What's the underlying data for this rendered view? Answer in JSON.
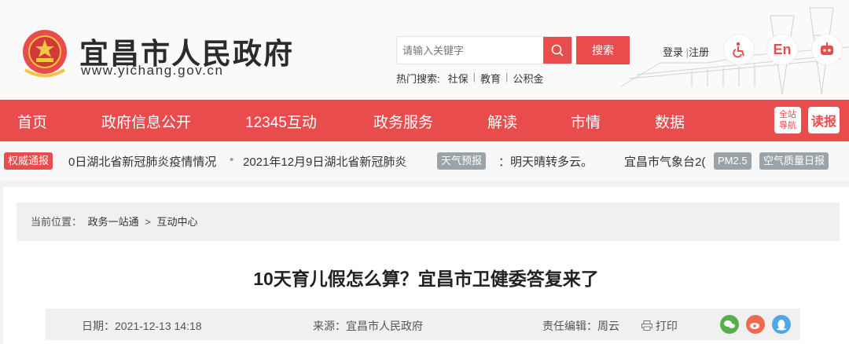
{
  "header": {
    "title": "宜昌市人民政府",
    "url": "www.yichang.gov.cn",
    "search": {
      "placeholder": "请输入关键字",
      "button": "搜索"
    },
    "hot": {
      "label": "热门搜索:",
      "items": [
        "社保",
        "教育",
        "公积金"
      ]
    },
    "login": "登录",
    "register": "注册",
    "en_label": "En",
    "colors": {
      "brand": "#e94c4c"
    }
  },
  "nav": {
    "items": [
      "首页",
      "政府信息公开",
      "12345互动",
      "政务服务",
      "解读",
      "市情",
      "数据"
    ],
    "small_tag": [
      "全站",
      "导航"
    ],
    "read_tag": "读报"
  },
  "ticker": {
    "badge": "权威通报",
    "text1": "0日湖北省新冠肺炎疫情情况",
    "text2": "2021年12月9日湖北省新冠肺炎",
    "weather_badge": "天气预报",
    "weather_text": "：明天晴转多云。",
    "weather_src": "宜昌市气象台2(",
    "pm_badge": "PM2.5",
    "air_badge": "空气质量日报"
  },
  "article": {
    "breadcrumb": {
      "label": "当前位置：",
      "path": [
        "政务一站通",
        ">",
        "互动中心"
      ]
    },
    "title": "10天育儿假怎么算？宜昌市卫健委答复来了",
    "meta": {
      "date_label": "日期：",
      "date": "2021-12-13 14:18",
      "source_label": "来源：",
      "source": "宜昌市人民政府",
      "editor_label": "责任编辑：",
      "editor": "周云",
      "print": "打印"
    }
  }
}
